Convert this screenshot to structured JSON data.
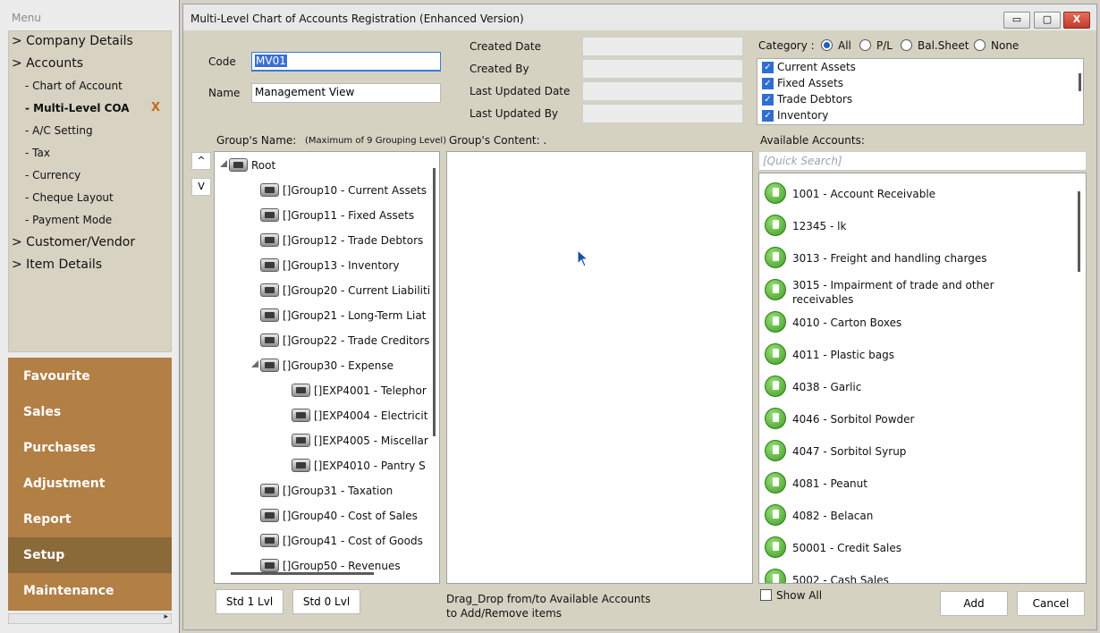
{
  "menu": {
    "title": "Menu",
    "items": [
      {
        "label": "> Company Details"
      },
      {
        "label": "> Accounts"
      },
      {
        "label": "- Chart of Account"
      },
      {
        "label": "- Multi-Level COA"
      },
      {
        "label": "- A/C Setting"
      },
      {
        "label": "- Tax"
      },
      {
        "label": "- Currency"
      },
      {
        "label": "- Cheque Layout"
      },
      {
        "label": "- Payment Mode"
      },
      {
        "label": "> Customer/Vendor"
      },
      {
        "label": "> Item Details"
      }
    ],
    "close_mark": "X",
    "sections": [
      "Favourite",
      "Sales",
      "Purchases",
      "Adjustment",
      "Report",
      "Setup",
      "Maintenance"
    ],
    "active_section": "Setup",
    "bottom_arrow": "▸"
  },
  "dialog": {
    "title": "Multi-Level Chart of Accounts Registration (Enhanced Version)",
    "buttons": {
      "min": "▭",
      "max": "▢",
      "close": "X"
    },
    "code_label": "Code",
    "code_value": "MV01",
    "name_label": "Name",
    "name_value": "Management View",
    "created_date_label": "Created Date",
    "created_by_label": "Created By",
    "last_updated_date_label": "Last Updated Date",
    "last_updated_by_label": "Last Updated By",
    "category": {
      "label": "Category :",
      "options": [
        "All",
        "P/L",
        "Bal.Sheet",
        "None"
      ],
      "selected": "All",
      "list": [
        {
          "label": "Current Assets",
          "checked": true
        },
        {
          "label": "Fixed Assets",
          "checked": true
        },
        {
          "label": "Trade Debtors",
          "checked": true
        },
        {
          "label": "Inventory",
          "checked": true
        }
      ]
    },
    "groups_name_label": "Group's Name:",
    "groups_name_note": "(Maximum of 9 Grouping Level)",
    "groups_content_label": "Group's Content: .",
    "available_label": "Available Accounts:",
    "search_placeholder": "[Quick Search]",
    "up_btn": "^",
    "down_btn": "V",
    "tree": [
      {
        "label": "Root",
        "level": 0
      },
      {
        "label": "[]Group10 - Current Assets",
        "level": 1
      },
      {
        "label": "[]Group11 - Fixed Assets",
        "level": 1
      },
      {
        "label": "[]Group12 - Trade Debtors",
        "level": 1
      },
      {
        "label": "[]Group13 - Inventory",
        "level": 1
      },
      {
        "label": "[]Group20 - Current Liabiliti",
        "level": 1
      },
      {
        "label": "[]Group21 - Long-Term Liat",
        "level": 1
      },
      {
        "label": "[]Group22 - Trade Creditors",
        "level": 1
      },
      {
        "label": "[]Group30 - Expense",
        "level": 1
      },
      {
        "label": "[]EXP4001 - Telephor",
        "level": 2
      },
      {
        "label": "[]EXP4004 - Electricit",
        "level": 2
      },
      {
        "label": "[]EXP4005 - Miscellar",
        "level": 2
      },
      {
        "label": "[]EXP4010 - Pantry S",
        "level": 2
      },
      {
        "label": "[]Group31 - Taxation",
        "level": 1
      },
      {
        "label": "[]Group40 - Cost of Sales",
        "level": 1
      },
      {
        "label": "[]Group41 - Cost of Goods",
        "level": 1
      },
      {
        "label": "[]Group50 - Revenues",
        "level": 1
      }
    ],
    "accounts": [
      {
        "label": "1001 - Account Receivable"
      },
      {
        "label": "12345 - lk"
      },
      {
        "label": "3013 - Freight and handling charges"
      },
      {
        "label": "3015 - Impairment of trade and other",
        "label2": "receivables"
      },
      {
        "label": "4010 - Carton Boxes"
      },
      {
        "label": "4011 - Plastic bags"
      },
      {
        "label": "4038 - Garlic"
      },
      {
        "label": "4046 - Sorbitol Powder"
      },
      {
        "label": "4047 - Sorbitol Syrup"
      },
      {
        "label": "4081 - Peanut"
      },
      {
        "label": "4082 - Belacan"
      },
      {
        "label": "50001 - Credit Sales"
      },
      {
        "label": "5002 - Cash Sales"
      }
    ],
    "std1_btn": "Std 1 Lvl",
    "std0_btn": "Std 0 Lvl",
    "drag_hint_1": "Drag_Drop from/to Available Accounts",
    "drag_hint_2": "to Add/Remove items",
    "show_all_label": "Show All",
    "add_btn": "Add",
    "cancel_btn": "Cancel"
  }
}
